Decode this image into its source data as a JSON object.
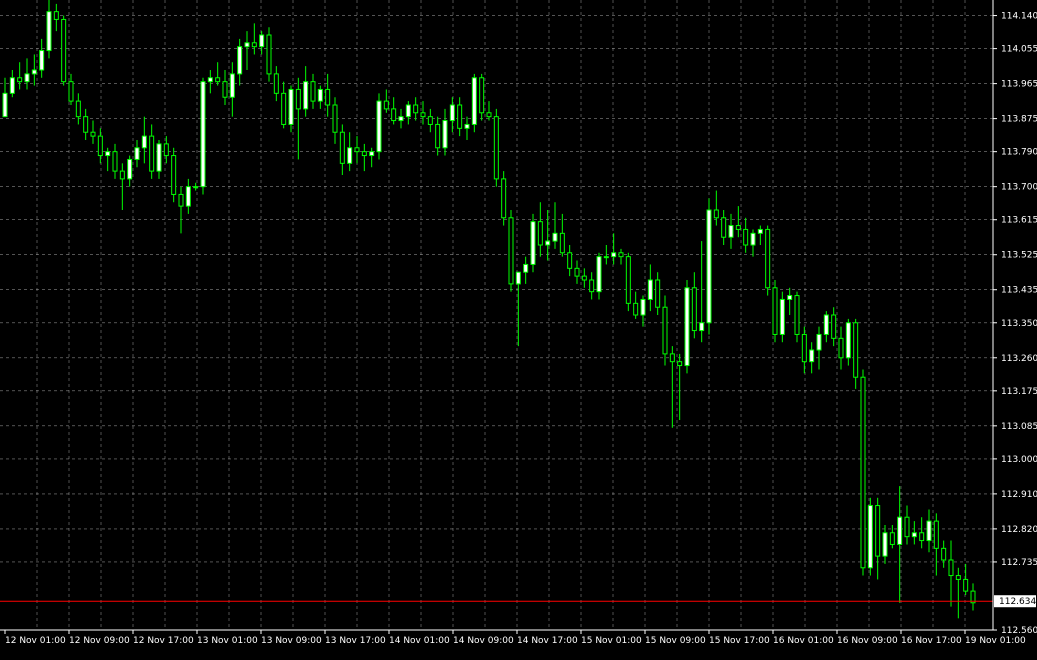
{
  "chart_data": {
    "type": "candlestick",
    "title": "",
    "xlabel": "",
    "ylabel": "",
    "grid": true,
    "ylim": [
      112.56,
      114.18
    ],
    "y_ticks": [
      "114.140",
      "114.055",
      "113.965",
      "113.875",
      "113.790",
      "113.700",
      "113.615",
      "113.525",
      "113.435",
      "113.350",
      "113.260",
      "113.175",
      "113.085",
      "113.000",
      "112.910",
      "112.820",
      "112.735",
      "112.560"
    ],
    "x_ticks": [
      "12 Nov 01:00",
      "12 Nov 09:00",
      "12 Nov 17:00",
      "13 Nov 01:00",
      "13 Nov 09:00",
      "13 Nov 17:00",
      "14 Nov 01:00",
      "14 Nov 09:00",
      "14 Nov 17:00",
      "15 Nov 01:00",
      "15 Nov 09:00",
      "15 Nov 17:00",
      "16 Nov 01:00",
      "16 Nov 09:00",
      "16 Nov 17:00",
      "19 Nov 01:00"
    ],
    "current_price": "112.634",
    "colors": {
      "background": "#000000",
      "grid": "#c0c0c0",
      "bull_body": "#ffffff",
      "bear_body": "#000000",
      "wick": "#00ff00",
      "price_line": "#ff0000",
      "axis_text": "#ffffff",
      "price_label_bg": "#ffffff",
      "price_label_text": "#000000"
    },
    "candles": [
      [
        113.88,
        113.98,
        113.88,
        113.94
      ],
      [
        113.94,
        114.0,
        113.93,
        113.98
      ],
      [
        113.98,
        114.02,
        113.95,
        113.97
      ],
      [
        113.97,
        114.03,
        113.95,
        113.99
      ],
      [
        113.99,
        114.04,
        113.96,
        114.0
      ],
      [
        114.0,
        114.08,
        113.98,
        114.05
      ],
      [
        114.05,
        114.18,
        114.03,
        114.15
      ],
      [
        114.15,
        114.17,
        114.1,
        114.13
      ],
      [
        114.13,
        114.14,
        113.96,
        113.97
      ],
      [
        113.97,
        113.99,
        113.91,
        113.92
      ],
      [
        113.92,
        113.94,
        113.86,
        113.88
      ],
      [
        113.88,
        113.9,
        113.82,
        113.84
      ],
      [
        113.84,
        113.87,
        113.81,
        113.83
      ],
      [
        113.83,
        113.85,
        113.76,
        113.78
      ],
      [
        113.78,
        113.8,
        113.74,
        113.79
      ],
      [
        113.79,
        113.81,
        113.72,
        113.74
      ],
      [
        113.74,
        113.76,
        113.64,
        113.72
      ],
      [
        113.72,
        113.78,
        113.7,
        113.77
      ],
      [
        113.77,
        113.82,
        113.75,
        113.8
      ],
      [
        113.8,
        113.88,
        113.76,
        113.83
      ],
      [
        113.83,
        113.86,
        113.72,
        113.74
      ],
      [
        113.74,
        113.82,
        113.72,
        113.81
      ],
      [
        113.81,
        113.83,
        113.76,
        113.78
      ],
      [
        113.78,
        113.8,
        113.66,
        113.68
      ],
      [
        113.68,
        113.7,
        113.58,
        113.65
      ],
      [
        113.65,
        113.72,
        113.63,
        113.7
      ],
      [
        113.7,
        113.71,
        113.69,
        113.7
      ],
      [
        113.7,
        113.98,
        113.68,
        113.97
      ],
      [
        113.97,
        114.0,
        113.94,
        113.98
      ],
      [
        113.98,
        114.02,
        113.96,
        113.97
      ],
      [
        113.97,
        114.0,
        113.91,
        113.93
      ],
      [
        113.93,
        114.02,
        113.88,
        113.99
      ],
      [
        113.99,
        114.08,
        113.96,
        114.06
      ],
      [
        114.06,
        114.1,
        114.0,
        114.07
      ],
      [
        114.07,
        114.12,
        114.04,
        114.06
      ],
      [
        114.06,
        114.1,
        114.04,
        114.09
      ],
      [
        114.09,
        114.11,
        113.97,
        113.99
      ],
      [
        113.99,
        114.01,
        113.92,
        113.94
      ],
      [
        113.94,
        113.97,
        113.85,
        113.86
      ],
      [
        113.86,
        113.96,
        113.84,
        113.95
      ],
      [
        113.95,
        113.98,
        113.77,
        113.9
      ],
      [
        113.9,
        114.01,
        113.88,
        113.97
      ],
      [
        113.97,
        113.99,
        113.9,
        113.92
      ],
      [
        113.92,
        113.96,
        113.9,
        113.95
      ],
      [
        113.95,
        113.99,
        113.88,
        113.91
      ],
      [
        113.91,
        113.93,
        113.81,
        113.84
      ],
      [
        113.84,
        113.86,
        113.73,
        113.76
      ],
      [
        113.76,
        113.84,
        113.74,
        113.8
      ],
      [
        113.8,
        113.83,
        113.76,
        113.79
      ],
      [
        113.79,
        113.81,
        113.74,
        113.78
      ],
      [
        113.78,
        113.8,
        113.75,
        113.79
      ],
      [
        113.79,
        113.94,
        113.77,
        113.92
      ],
      [
        113.92,
        113.95,
        113.89,
        113.9
      ],
      [
        113.9,
        113.93,
        113.86,
        113.87
      ],
      [
        113.87,
        113.9,
        113.85,
        113.88
      ],
      [
        113.88,
        113.92,
        113.86,
        113.91
      ],
      [
        113.91,
        113.93,
        113.87,
        113.89
      ],
      [
        113.89,
        113.92,
        113.86,
        113.88
      ],
      [
        113.88,
        113.9,
        113.84,
        113.86
      ],
      [
        113.86,
        113.88,
        113.78,
        113.8
      ],
      [
        113.8,
        113.9,
        113.78,
        113.87
      ],
      [
        113.87,
        113.93,
        113.84,
        113.91
      ],
      [
        113.91,
        113.93,
        113.83,
        113.85
      ],
      [
        113.85,
        113.88,
        113.82,
        113.86
      ],
      [
        113.86,
        113.99,
        113.84,
        113.98
      ],
      [
        113.98,
        113.99,
        113.87,
        113.89
      ],
      [
        113.89,
        113.92,
        113.87,
        113.88
      ],
      [
        113.88,
        113.9,
        113.7,
        113.72
      ],
      [
        113.72,
        113.74,
        113.6,
        113.62
      ],
      [
        113.62,
        113.64,
        113.43,
        113.45
      ],
      [
        113.45,
        113.47,
        113.29,
        113.48
      ],
      [
        113.48,
        113.52,
        113.45,
        113.5
      ],
      [
        113.5,
        113.63,
        113.48,
        113.61
      ],
      [
        113.61,
        113.66,
        113.52,
        113.55
      ],
      [
        113.55,
        113.64,
        113.51,
        113.56
      ],
      [
        113.56,
        113.66,
        113.54,
        113.58
      ],
      [
        113.58,
        113.63,
        113.52,
        113.53
      ],
      [
        113.53,
        113.55,
        113.47,
        113.49
      ],
      [
        113.49,
        113.51,
        113.45,
        113.47
      ],
      [
        113.47,
        113.49,
        113.44,
        113.46
      ],
      [
        113.46,
        113.48,
        113.41,
        113.43
      ],
      [
        113.43,
        113.53,
        113.41,
        113.52
      ],
      [
        113.52,
        113.55,
        113.5,
        113.52
      ],
      [
        113.52,
        113.58,
        113.5,
        113.53
      ],
      [
        113.53,
        113.54,
        113.5,
        113.52
      ],
      [
        113.52,
        113.53,
        113.38,
        113.4
      ],
      [
        113.4,
        113.43,
        113.36,
        113.37
      ],
      [
        113.37,
        113.42,
        113.34,
        113.41
      ],
      [
        113.41,
        113.5,
        113.38,
        113.46
      ],
      [
        113.46,
        113.48,
        113.37,
        113.39
      ],
      [
        113.39,
        113.42,
        113.24,
        113.27
      ],
      [
        113.27,
        113.29,
        113.08,
        113.25
      ],
      [
        113.25,
        113.27,
        113.1,
        113.24
      ],
      [
        113.24,
        113.46,
        113.22,
        113.44
      ],
      [
        113.44,
        113.48,
        113.31,
        113.33
      ],
      [
        113.33,
        113.56,
        113.3,
        113.35
      ],
      [
        113.35,
        113.67,
        113.32,
        113.64
      ],
      [
        113.64,
        113.69,
        113.6,
        113.62
      ],
      [
        113.62,
        113.64,
        113.55,
        113.57
      ],
      [
        113.57,
        113.63,
        113.54,
        113.6
      ],
      [
        113.6,
        113.65,
        113.57,
        113.59
      ],
      [
        113.59,
        113.62,
        113.53,
        113.55
      ],
      [
        113.55,
        113.59,
        113.52,
        113.58
      ],
      [
        113.58,
        113.6,
        113.55,
        113.59
      ],
      [
        113.59,
        113.6,
        113.42,
        113.44
      ],
      [
        113.44,
        113.46,
        113.3,
        113.32
      ],
      [
        113.32,
        113.43,
        113.3,
        113.41
      ],
      [
        113.41,
        113.44,
        113.37,
        113.42
      ],
      [
        113.42,
        113.43,
        113.3,
        113.32
      ],
      [
        113.32,
        113.34,
        113.22,
        113.25
      ],
      [
        113.25,
        113.3,
        113.22,
        113.28
      ],
      [
        113.28,
        113.34,
        113.23,
        113.32
      ],
      [
        113.32,
        113.38,
        113.3,
        113.37
      ],
      [
        113.37,
        113.39,
        113.29,
        113.31
      ],
      [
        113.31,
        113.34,
        113.23,
        113.26
      ],
      [
        113.26,
        113.36,
        113.24,
        113.35
      ],
      [
        113.35,
        113.36,
        113.18,
        113.21
      ],
      [
        113.21,
        113.23,
        112.7,
        112.72
      ],
      [
        112.72,
        112.9,
        112.7,
        112.88
      ],
      [
        112.88,
        112.9,
        112.69,
        112.75
      ],
      [
        112.75,
        112.83,
        112.73,
        112.81
      ],
      [
        112.81,
        112.83,
        112.77,
        112.78
      ],
      [
        112.78,
        112.93,
        112.63,
        112.85
      ],
      [
        112.85,
        112.88,
        112.78,
        112.8
      ],
      [
        112.8,
        112.84,
        112.78,
        112.81
      ],
      [
        112.81,
        112.85,
        112.77,
        112.79
      ],
      [
        112.79,
        112.87,
        112.76,
        112.84
      ],
      [
        112.84,
        112.86,
        112.7,
        112.77
      ],
      [
        112.77,
        112.79,
        112.72,
        112.74
      ],
      [
        112.74,
        112.79,
        112.62,
        112.7
      ],
      [
        112.7,
        112.72,
        112.59,
        112.69
      ],
      [
        112.69,
        112.73,
        112.65,
        112.66
      ],
      [
        112.66,
        112.68,
        112.61,
        112.63
      ]
    ]
  }
}
